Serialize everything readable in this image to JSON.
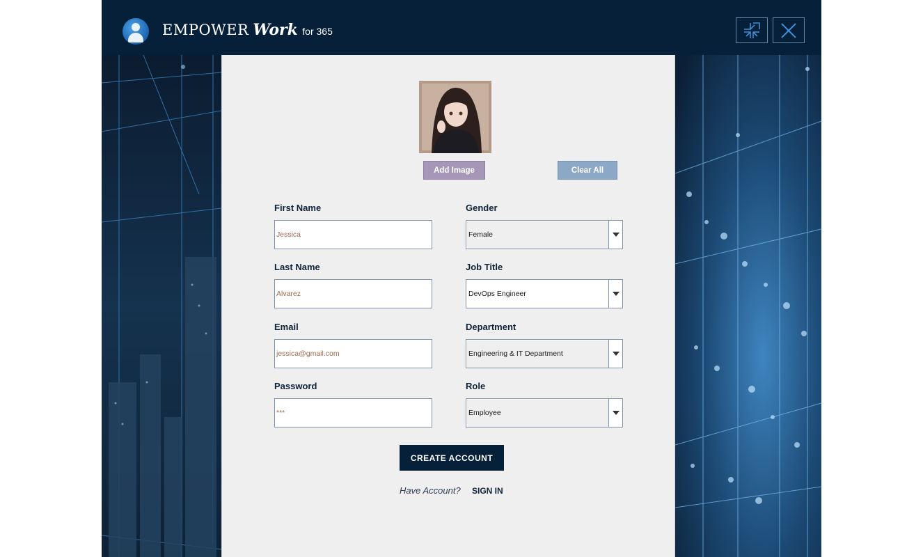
{
  "window": {
    "brand_main": "EMPOWER",
    "brand_work": "Work",
    "brand_suffix": "for 365",
    "logo_icon": "user-avatar-logo-icon",
    "minimize_icon": "collapse-arrows-icon",
    "close_icon": "close-icon"
  },
  "form": {
    "add_image_label": "Add Image",
    "clear_all_label": "Clear All",
    "first_name_label": "First Name",
    "first_name_value": "Jessica",
    "last_name_label": "Last Name",
    "last_name_value": "Alvarez",
    "email_label": "Email",
    "email_value": "jessica@gmail.com",
    "password_label": "Password",
    "password_value": "***",
    "gender_label": "Gender",
    "gender_value": "Female",
    "job_title_label": "Job Title",
    "job_title_value": "DevOps Engineer",
    "department_label": "Department",
    "department_value": "Engineering & IT Department",
    "role_label": "Role",
    "role_value": "Employee",
    "create_account_label": "CREATE ACCOUNT",
    "have_account_text": "Have Account?",
    "sign_in_label": "SIGN IN"
  },
  "colors": {
    "titlebar": "#06203a",
    "panel": "#efefef",
    "add_image_button": "#a697b8",
    "clear_all_button": "#8ca8c7",
    "primary_button": "#06203a",
    "label_text": "#0e2238",
    "input_text": "#a06a4e"
  }
}
